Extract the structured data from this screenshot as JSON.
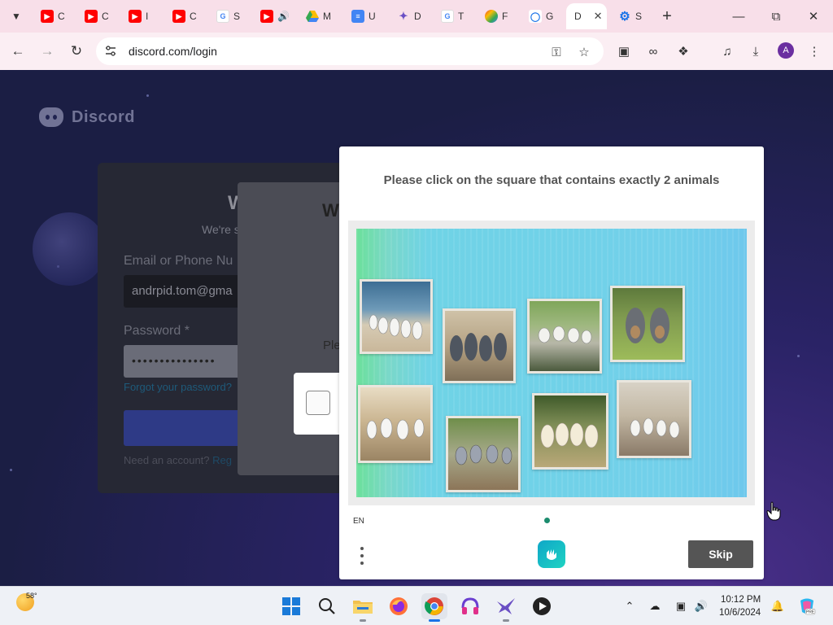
{
  "browser": {
    "tabs": [
      {
        "label": "C",
        "icon": "youtube-icon",
        "color": "#ff0000"
      },
      {
        "label": "C",
        "icon": "youtube-icon",
        "color": "#ff0000"
      },
      {
        "label": "I",
        "icon": "youtube-icon",
        "color": "#ff0000"
      },
      {
        "label": "C",
        "icon": "youtube-icon",
        "color": "#ff0000"
      },
      {
        "label": "S",
        "icon": "google-icon",
        "color": "#4285f4"
      },
      {
        "label": "",
        "icon": "youtube-audio-icon",
        "color": "#ff0000"
      },
      {
        "label": "M",
        "icon": "google-drive-icon",
        "color": "#34a853"
      },
      {
        "label": "U",
        "icon": "google-docs-icon",
        "color": "#4285f4"
      },
      {
        "label": "D",
        "icon": "bird-app-icon",
        "color": "#6a4fc4"
      },
      {
        "label": "T",
        "icon": "google-icon",
        "color": "#4285f4"
      },
      {
        "label": "F",
        "icon": "gemini-icon",
        "color": "#8a5cf6"
      },
      {
        "label": "G",
        "icon": "key-icon",
        "color": "#1a73e8"
      },
      {
        "label": "D",
        "icon": "discord-icon",
        "color": "#5865f2",
        "active": true
      },
      {
        "label": "S",
        "icon": "settings-gear-icon",
        "color": "#1a73e8"
      }
    ],
    "url": "discord.com/login",
    "profile_initial": "A"
  },
  "login": {
    "brand": "Discord",
    "heading": "W",
    "subheading": "We're s",
    "email_label": "Email or Phone Nu",
    "email_value": "andrpid.tom@gma",
    "password_label": "Password *",
    "password_value": "•••••••••••••••",
    "forgot_link": "Forgot your password?",
    "need_account": "Need an account?",
    "register_link": "Reg"
  },
  "captcha_widget": {
    "title": "W",
    "subtitle": "Ple"
  },
  "challenge": {
    "prompt": "Please click on the square that contains exactly 2 animals",
    "language": "EN",
    "skip_label": "Skip",
    "photos": [
      {
        "animal": "seagulls",
        "count": 5
      },
      {
        "animal": "grey dogs",
        "count": 4
      },
      {
        "animal": "seagulls",
        "count": 4
      },
      {
        "animal": "grey dogs",
        "count": 2
      },
      {
        "animal": "seagulls",
        "count": 4
      },
      {
        "animal": "pigeons",
        "count": 4
      },
      {
        "animal": "white dogs",
        "count": 4
      },
      {
        "animal": "seagulls",
        "count": 4
      }
    ]
  },
  "taskbar": {
    "temperature": "58°",
    "time": "10:12 PM",
    "date": "10/6/2024"
  },
  "colors": {
    "tabstrip": "#f8dfe9",
    "page_bg": "#1b1e44",
    "challenge_accent": "#1c8c6e",
    "skip_button": "#555555"
  }
}
